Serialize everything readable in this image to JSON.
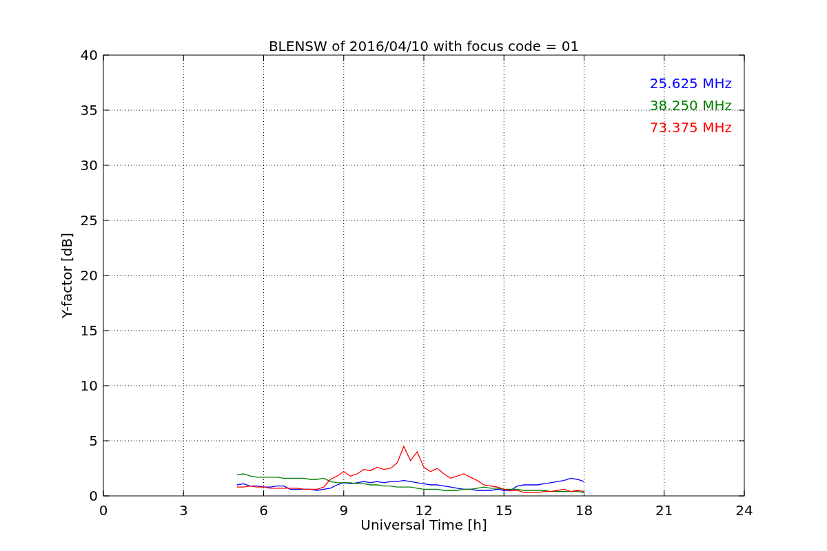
{
  "figure": {
    "chart_data": {
      "type": "line",
      "title": "BLENSW of 2016/04/10 with focus code = 01",
      "xlabel": "Universal Time [h]",
      "ylabel": "Y-factor [dB]",
      "grid": true,
      "xlim": [
        0,
        24
      ],
      "ylim": [
        0,
        40
      ],
      "xticks": [
        0,
        3,
        6,
        9,
        12,
        15,
        18,
        21,
        24
      ],
      "yticks": [
        0,
        5,
        10,
        15,
        20,
        25,
        30,
        35,
        40
      ],
      "x": [
        5,
        5.25,
        5.5,
        5.75,
        6,
        6.25,
        6.5,
        6.75,
        7,
        7.25,
        7.5,
        7.75,
        8,
        8.25,
        8.5,
        8.75,
        9,
        9.25,
        9.5,
        9.75,
        10,
        10.25,
        10.5,
        10.75,
        11,
        11.25,
        11.5,
        11.75,
        12,
        12.25,
        12.5,
        12.75,
        13,
        13.25,
        13.5,
        13.75,
        14,
        14.25,
        14.5,
        14.75,
        15,
        15.25,
        15.5,
        15.75,
        16,
        16.25,
        16.5,
        16.75,
        17,
        17.25,
        17.5,
        17.75,
        18
      ],
      "series": [
        {
          "name": "25.625 MHz",
          "color": "#0000ff",
          "values": [
            1.0,
            1.1,
            0.9,
            0.9,
            0.8,
            0.8,
            0.9,
            0.9,
            0.6,
            0.6,
            0.6,
            0.6,
            0.5,
            0.6,
            0.7,
            1.0,
            1.2,
            1.1,
            1.2,
            1.3,
            1.2,
            1.3,
            1.2,
            1.3,
            1.3,
            1.4,
            1.3,
            1.2,
            1.1,
            1.0,
            1.0,
            0.9,
            0.8,
            0.7,
            0.6,
            0.6,
            0.5,
            0.5,
            0.5,
            0.6,
            0.5,
            0.5,
            0.9,
            1.0,
            1.0,
            1.0,
            1.1,
            1.2,
            1.3,
            1.4,
            1.6,
            1.5,
            1.3
          ]
        },
        {
          "name": "38.250 MHz",
          "color": "#008000",
          "values": [
            1.9,
            2.0,
            1.8,
            1.7,
            1.7,
            1.7,
            1.7,
            1.6,
            1.6,
            1.6,
            1.6,
            1.5,
            1.5,
            1.6,
            1.3,
            1.2,
            1.2,
            1.2,
            1.1,
            1.1,
            1.0,
            1.0,
            0.9,
            0.9,
            0.8,
            0.8,
            0.8,
            0.7,
            0.6,
            0.6,
            0.6,
            0.5,
            0.5,
            0.5,
            0.6,
            0.6,
            0.7,
            0.8,
            0.7,
            0.7,
            0.6,
            0.6,
            0.6,
            0.5,
            0.5,
            0.5,
            0.5,
            0.4,
            0.4,
            0.4,
            0.4,
            0.4,
            0.3
          ]
        },
        {
          "name": "73.375 MHz",
          "color": "#ff0000",
          "values": [
            0.8,
            0.8,
            0.9,
            0.8,
            0.8,
            0.7,
            0.7,
            0.7,
            0.7,
            0.7,
            0.6,
            0.6,
            0.6,
            0.8,
            1.5,
            1.8,
            2.2,
            1.8,
            2.0,
            2.4,
            2.3,
            2.6,
            2.4,
            2.5,
            3.0,
            4.5,
            3.2,
            4.0,
            2.6,
            2.2,
            2.5,
            2.0,
            1.6,
            1.8,
            2.0,
            1.7,
            1.4,
            1.0,
            0.9,
            0.8,
            0.6,
            0.5,
            0.5,
            0.3,
            0.3,
            0.3,
            0.4,
            0.4,
            0.5,
            0.6,
            0.4,
            0.5,
            0.4
          ]
        }
      ]
    }
  }
}
